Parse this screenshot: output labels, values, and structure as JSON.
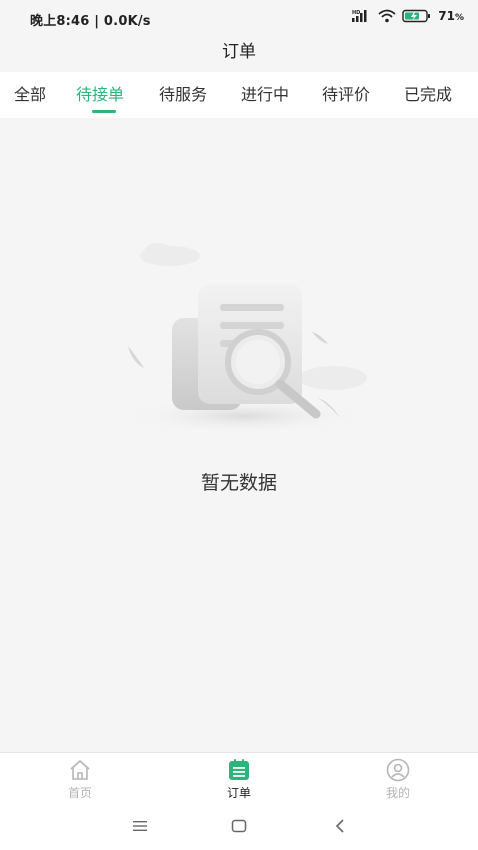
{
  "status_bar": {
    "left_text": "晚上8:46 | 0.0K/s",
    "battery": "71",
    "battery_unit": "%",
    "icons": [
      "hd-signal-icon",
      "wifi-icon",
      "battery-charging-icon"
    ]
  },
  "header": {
    "title": "订单"
  },
  "tabs": [
    {
      "label": "全部"
    },
    {
      "label": "待接单"
    },
    {
      "label": "待服务"
    },
    {
      "label": "进行中"
    },
    {
      "label": "待评价"
    },
    {
      "label": "已完成"
    }
  ],
  "active_tab": "待接单",
  "empty_state": {
    "text": "暂无数据",
    "icon": "empty-document-search-icon"
  },
  "bottom_tabs": [
    {
      "label": "首页",
      "icon": "home-icon"
    },
    {
      "label": "订单",
      "icon": "orders-icon"
    },
    {
      "label": "我的",
      "icon": "profile-icon"
    }
  ],
  "active_bottom_tab": "订单",
  "colors": {
    "accent": "#2bb57a",
    "background": "#f5f5f5",
    "inactive_label": "#b5b5b5"
  },
  "system_nav": [
    "menu-icon",
    "home-square-icon",
    "back-icon"
  ]
}
